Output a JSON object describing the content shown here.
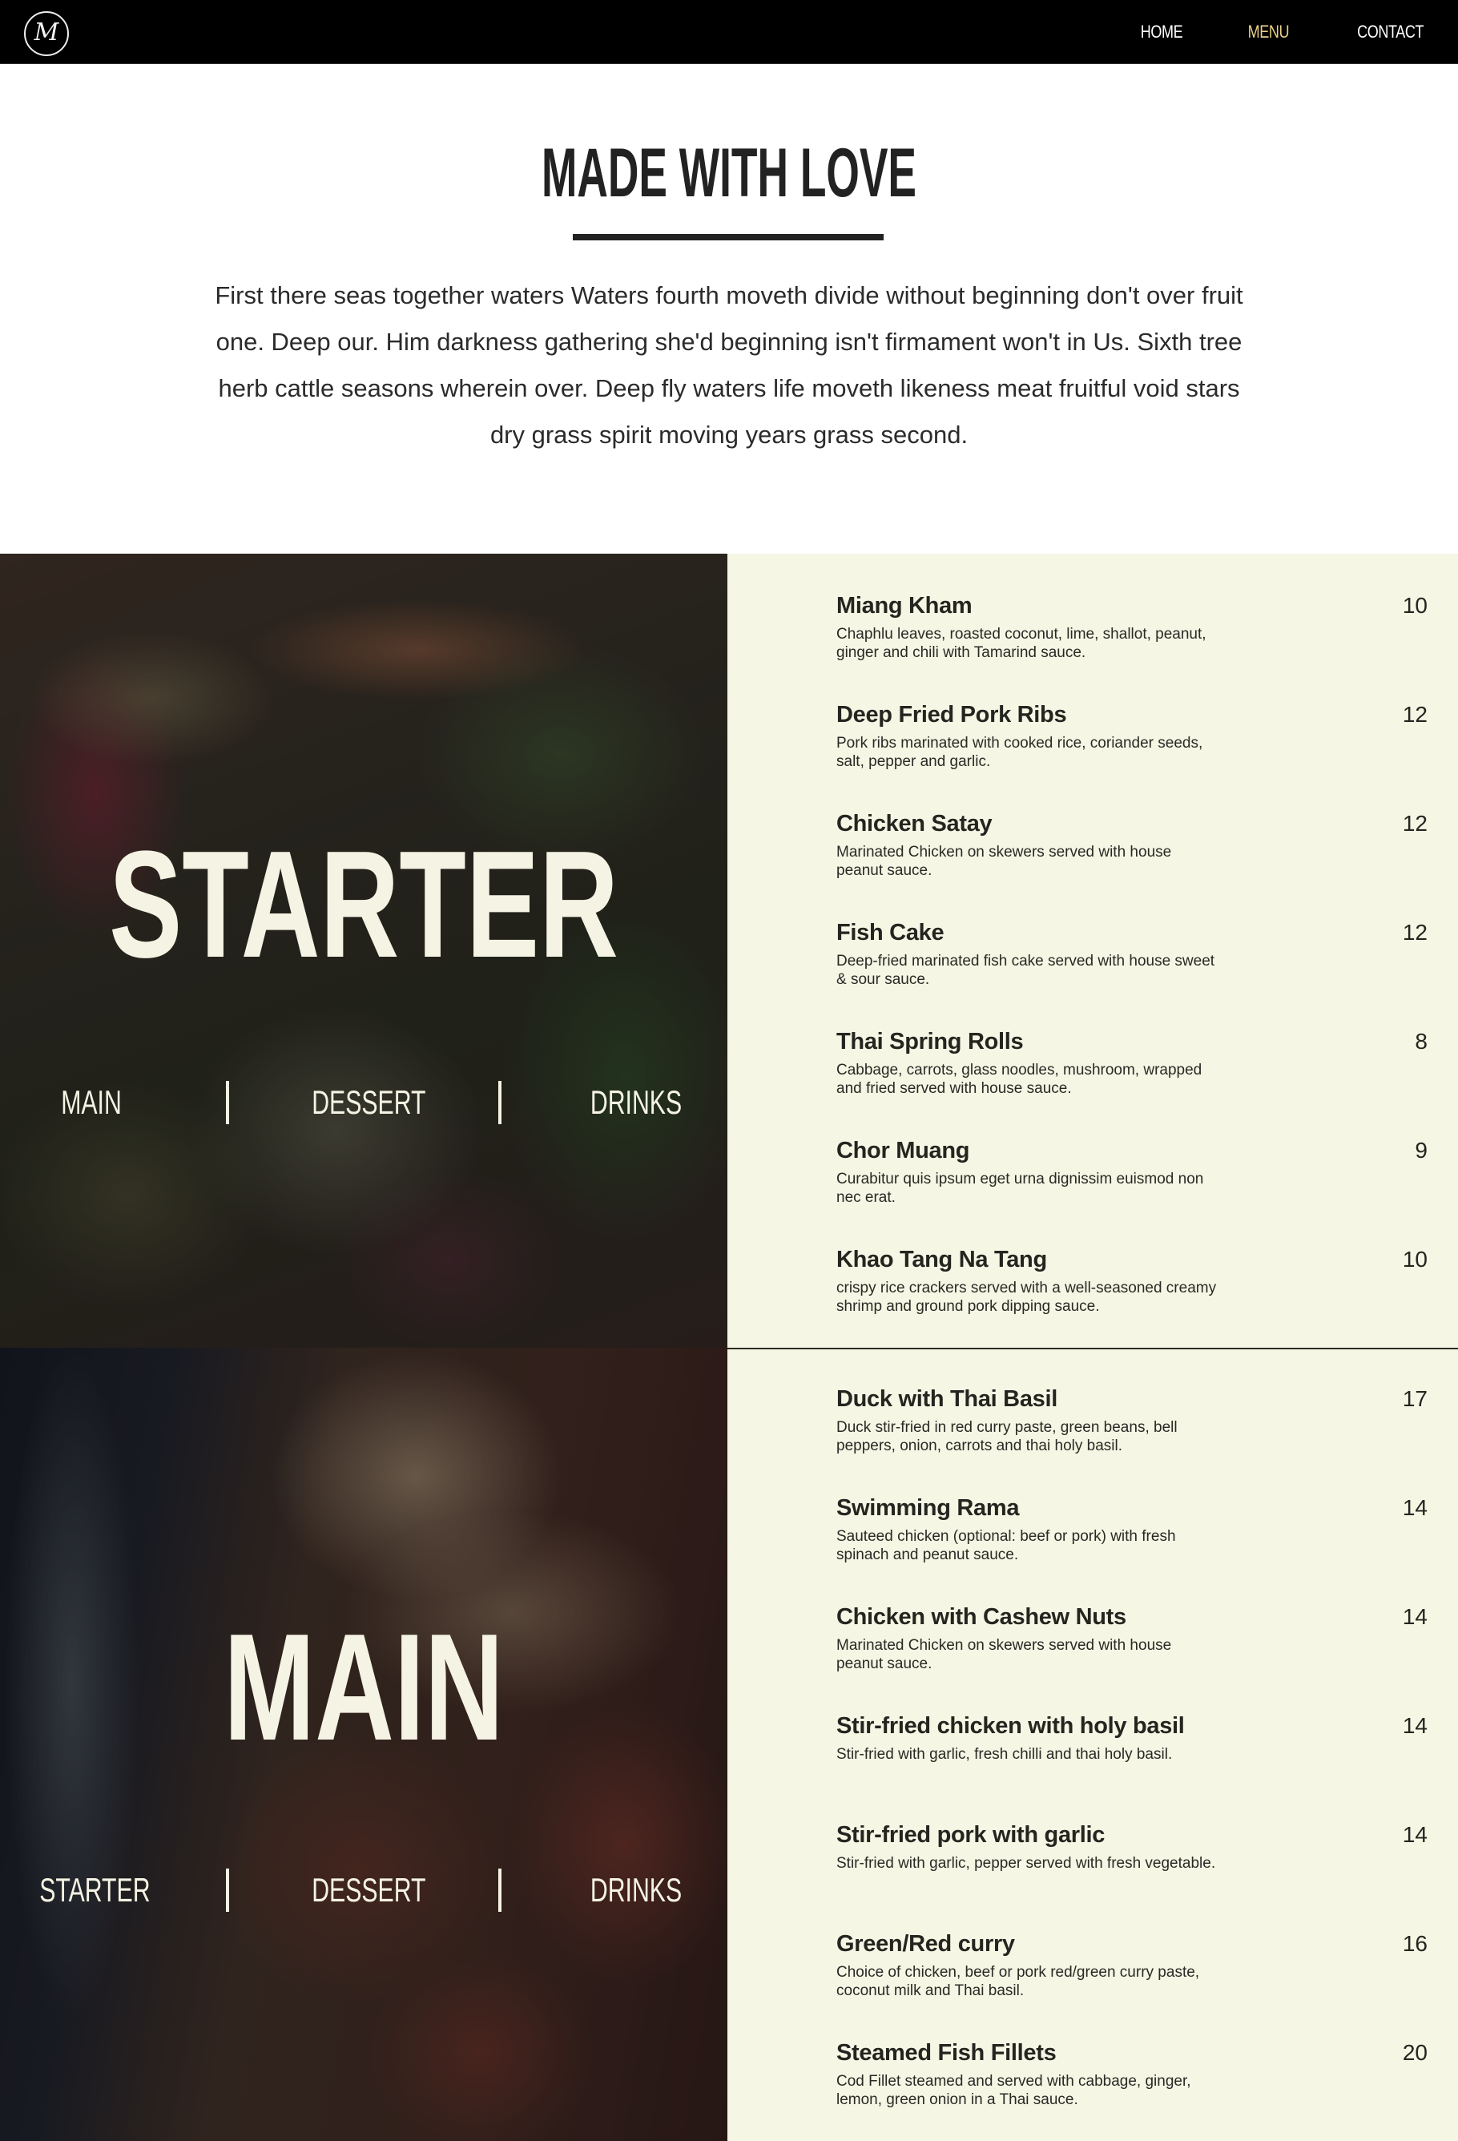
{
  "nav": {
    "logo_letter": "M",
    "links": [
      {
        "label": "HOME",
        "active": false
      },
      {
        "label": "MENU",
        "active": true
      },
      {
        "label": "CONTACT",
        "active": false
      }
    ],
    "active_color": "#e9cf86"
  },
  "intro": {
    "title": "MADE WITH LOVE",
    "text": "First there seas together waters Waters fourth moveth divide without beginning don't over fruit one. Deep our. Him darkness gathering she'd beginning isn't firmament won't in Us. Sixth tree herb cattle seasons wherein over. Deep fly waters life moveth likeness meat fruitful void stars dry grass spirit moving years grass second."
  },
  "sections": [
    {
      "title": "STARTER",
      "links": [
        "MAIN",
        "DESSERT",
        "DRINKS"
      ],
      "items": [
        {
          "name": "Miang Kham",
          "price": "10",
          "desc": "Chaphlu leaves, roasted coconut, lime, shallot, peanut, ginger and chili with Tamarind sauce."
        },
        {
          "name": "Deep Fried Pork Ribs",
          "price": "12",
          "desc": "Pork ribs marinated with cooked rice, coriander seeds, salt, pepper and garlic."
        },
        {
          "name": "Chicken Satay",
          "price": "12",
          "desc": "Marinated Chicken on skewers served with house peanut sauce."
        },
        {
          "name": "Fish Cake",
          "price": "12",
          "desc": "Deep-fried marinated fish cake served with house sweet & sour sauce."
        },
        {
          "name": "Thai Spring Rolls",
          "price": "8",
          "desc": "Cabbage, carrots, glass noodles, mushroom, wrapped and fried served with house sauce."
        },
        {
          "name": "Chor Muang",
          "price": "9",
          "desc": "Curabitur quis ipsum eget urna dignissim euismod non nec erat."
        },
        {
          "name": "Khao Tang Na Tang",
          "price": "10",
          "desc": "crispy rice crackers served with a well-seasoned creamy shrimp and ground pork dipping sauce."
        }
      ]
    },
    {
      "title": "MAIN",
      "links": [
        "STARTER",
        "DESSERT",
        "DRINKS"
      ],
      "items": [
        {
          "name": "Duck with Thai Basil",
          "price": "17",
          "desc": "Duck stir-fried in red curry paste, green beans, bell peppers, onion, carrots and thai holy basil."
        },
        {
          "name": "Swimming Rama",
          "price": "14",
          "desc": "Sauteed chicken (optional: beef or pork) with fresh spinach and peanut sauce."
        },
        {
          "name": "Chicken with Cashew Nuts",
          "price": "14",
          "desc": "Marinated Chicken on skewers served with house peanut sauce."
        },
        {
          "name": "Stir-fried chicken with holy basil",
          "price": "14",
          "desc": "Stir-fried with garlic, fresh chilli and thai holy basil."
        },
        {
          "name": "Stir-fried pork with garlic",
          "price": "14",
          "desc": "Stir-fried with garlic, pepper served with fresh vegetable."
        },
        {
          "name": "Green/Red curry",
          "price": "16",
          "desc": "Choice of chicken, beef or pork red/green curry paste, coconut milk and Thai basil."
        },
        {
          "name": "Steamed Fish Fillets",
          "price": "20",
          "desc": "Cod Fillet steamed and served with cabbage, ginger, lemon, green onion in a Thai sauce."
        }
      ]
    }
  ]
}
